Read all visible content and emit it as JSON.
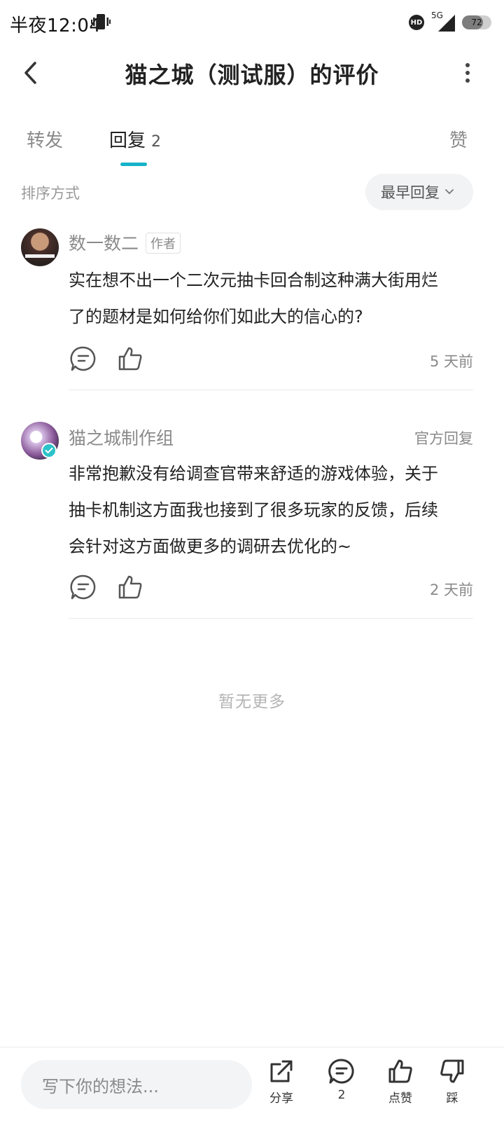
{
  "status_bar": {
    "time": "半夜12:04",
    "hd_label": "HD",
    "network": "5G",
    "battery": "72",
    "battery_level": 0.72
  },
  "header": {
    "title": "猫之城（测试服）的评价",
    "back_icon": "chevron-left-icon",
    "more_icon": "vertical-dots-icon"
  },
  "tabs": [
    {
      "label": "转发",
      "active": false
    },
    {
      "label": "回复",
      "count": "2",
      "active": true
    },
    {
      "label": "赞",
      "active": false
    }
  ],
  "accent_color": "#15b3c8",
  "sort": {
    "label": "排序方式",
    "selected": "最早回复"
  },
  "comments": [
    {
      "name": "数一数二",
      "tag": "作者",
      "text_line1": "实在想不出一个二次元抽卡回合制这种满大街用烂",
      "text_line2": "了的题材是如何给你们如此大的信心的?",
      "time": "5 天前"
    },
    {
      "name": "猫之城制作组",
      "tag": "官方回复",
      "text_line1": "非常抱歉没有给调查官带来舒适的游戏体验，关于",
      "text_line2": "抽卡机制这方面我也接到了很多玩家的反馈，后续",
      "text_line3": "会针对这方面做更多的调研去优化的~",
      "time": "2 天前"
    }
  ],
  "footer_note": "暂无更多",
  "bottom_bar": {
    "input_placeholder": "写下你的想法...",
    "share_label": "分享",
    "comment_count": "2",
    "like_label": "点赞",
    "dislike_label": "踩"
  }
}
